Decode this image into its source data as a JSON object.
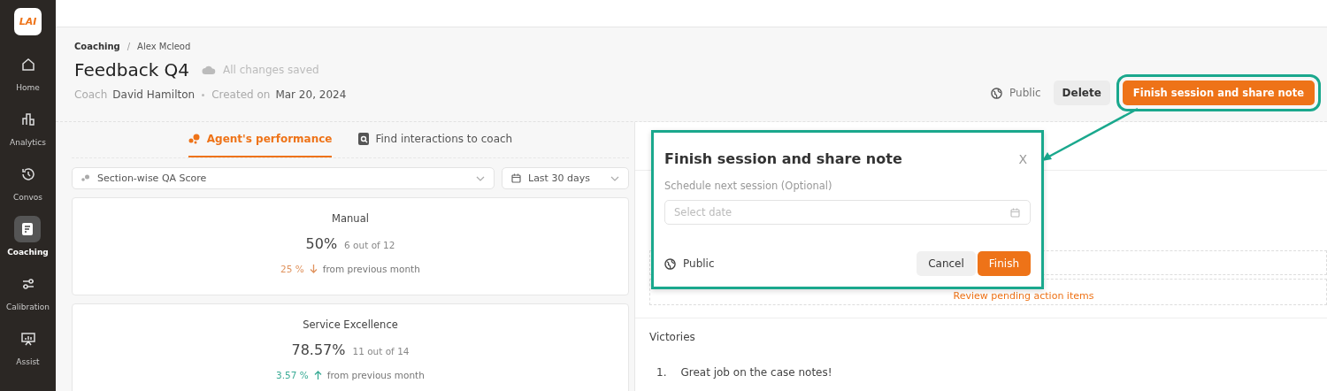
{
  "logo": "LAI",
  "nav": [
    {
      "label": "Home",
      "selected": false
    },
    {
      "label": "Analytics",
      "selected": false
    },
    {
      "label": "Convos",
      "selected": false
    },
    {
      "label": "Coaching",
      "selected": true
    },
    {
      "label": "Calibration",
      "selected": false
    },
    {
      "label": "Assist",
      "selected": false
    }
  ],
  "breadcrumb": [
    "Coaching",
    "/",
    "Alex Mcleod"
  ],
  "title": "Feedback Q4",
  "save_status": "All changes saved",
  "meta": {
    "coach_label": "Coach",
    "coach": "David Hamilton",
    "created_label": "Created on",
    "created": "Mar 20, 2024"
  },
  "header_actions": {
    "visibility": "Public",
    "delete": "Delete",
    "finish": "Finish session and share note"
  },
  "tabs": [
    {
      "label": "Agent's performance",
      "selected": true
    },
    {
      "label": "Find interactions to coach",
      "selected": false
    }
  ],
  "filters": {
    "metric": "Section-wise QA Score",
    "range": "Last 30 days"
  },
  "scores": [
    {
      "name": "Manual",
      "percent": "50%",
      "count": "6 out of 12",
      "delta": "25 %",
      "kind": "decrease",
      "note": "from previous month"
    },
    {
      "name": "Service Excellence",
      "percent": "78.57%",
      "count": "11 out of 14",
      "delta": "3.57 %",
      "kind": "increase",
      "note": "from previous month"
    }
  ],
  "action_link": "Review pending action items",
  "victories": {
    "title": "Victories",
    "items": [
      {
        "number": "1.",
        "text": "Great job on the case notes!"
      }
    ]
  },
  "dialog": {
    "title": "Finish session and share note",
    "close": "X",
    "field_label": "Schedule next session (Optional)",
    "placeholder": "Select date",
    "visibility": "Public",
    "cancel": "Cancel",
    "confirm": "Finish"
  }
}
